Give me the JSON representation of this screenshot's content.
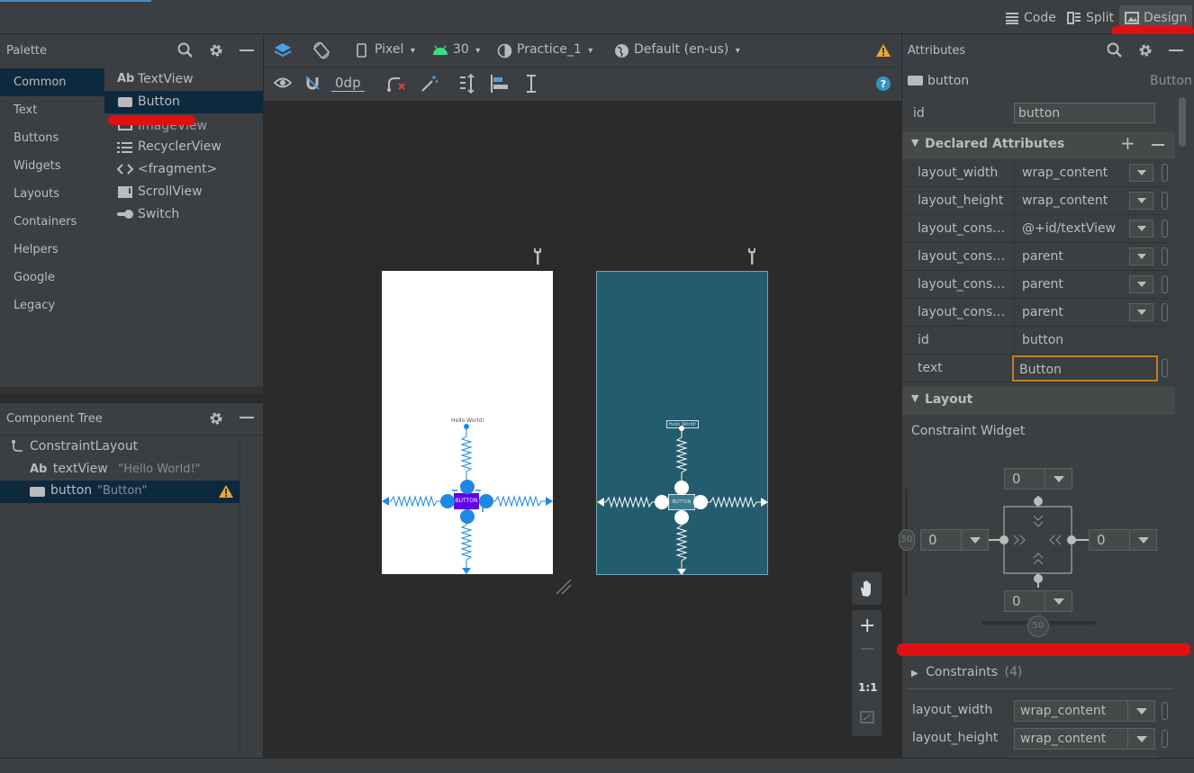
{
  "topbar": {
    "view_modes": [
      {
        "label": "Code",
        "icon": "code-lines-icon"
      },
      {
        "label": "Split",
        "icon": "split-view-icon"
      },
      {
        "label": "Design",
        "icon": "image-icon",
        "active": true
      }
    ]
  },
  "palette": {
    "title": "Palette",
    "categories": [
      "Common",
      "Text",
      "Buttons",
      "Widgets",
      "Layouts",
      "Containers",
      "Helpers",
      "Google",
      "Legacy"
    ],
    "selected_category": "Common",
    "items": [
      {
        "label": "TextView",
        "icon": "ab-text-icon"
      },
      {
        "label": "Button",
        "icon": "button-icon"
      },
      {
        "label": "ImageView",
        "icon": "image-icon"
      },
      {
        "label": "RecyclerView",
        "icon": "list-icon"
      },
      {
        "label": "<fragment>",
        "icon": "code-brackets-icon"
      },
      {
        "label": "ScrollView",
        "icon": "scrollview-icon"
      },
      {
        "label": "Switch",
        "icon": "switch-icon"
      }
    ],
    "text_badge": "Ab"
  },
  "component_tree": {
    "title": "Component Tree",
    "nodes": [
      {
        "label": "ConstraintLayout",
        "sub": ""
      },
      {
        "label": "textView",
        "sub": "\"Hello World!\""
      },
      {
        "label": "button",
        "sub": "\"Button\""
      }
    ]
  },
  "design_toolbar": {
    "device": "Pixel",
    "api": "30",
    "theme": "Practice_1",
    "locale": "Default (en-us)",
    "margin": "0dp"
  },
  "canvas": {
    "hello_text": "Hello World!",
    "button_text": "BUTTON",
    "zoom_label": "1:1",
    "colors": {
      "design_surface": "#ffffff",
      "blueprint_surface": "#235c6e",
      "selection": "#1e88e5",
      "button_purple": "#6200ee"
    }
  },
  "attributes": {
    "title": "Attributes",
    "component_name": "button",
    "component_type": "Button",
    "id_label": "id",
    "id_value": "button",
    "declared_title": "Declared Attributes",
    "declared": [
      {
        "label": "layout_width",
        "value": "wrap_content"
      },
      {
        "label": "layout_height",
        "value": "wrap_content"
      },
      {
        "label": "layout_constra...",
        "value": "@+id/textView"
      },
      {
        "label": "layout_constra...",
        "value": "parent"
      },
      {
        "label": "layout_constra...",
        "value": "parent"
      },
      {
        "label": "layout_constra...",
        "value": "parent"
      },
      {
        "label": "id",
        "value": "button"
      },
      {
        "label": "text",
        "value": "Button"
      }
    ],
    "layout_title": "Layout",
    "constraint_widget_title": "Constraint Widget",
    "margins": {
      "top": "0",
      "left": "0",
      "right": "0",
      "bottom": "0"
    },
    "bias_vertical": "50",
    "bias_horizontal": "50",
    "constraints_title": "Constraints",
    "constraints_count": "(4)",
    "layout_rows": [
      {
        "label": "layout_width",
        "value": "wrap_content"
      },
      {
        "label": "layout_height",
        "value": "wrap_content"
      }
    ]
  }
}
